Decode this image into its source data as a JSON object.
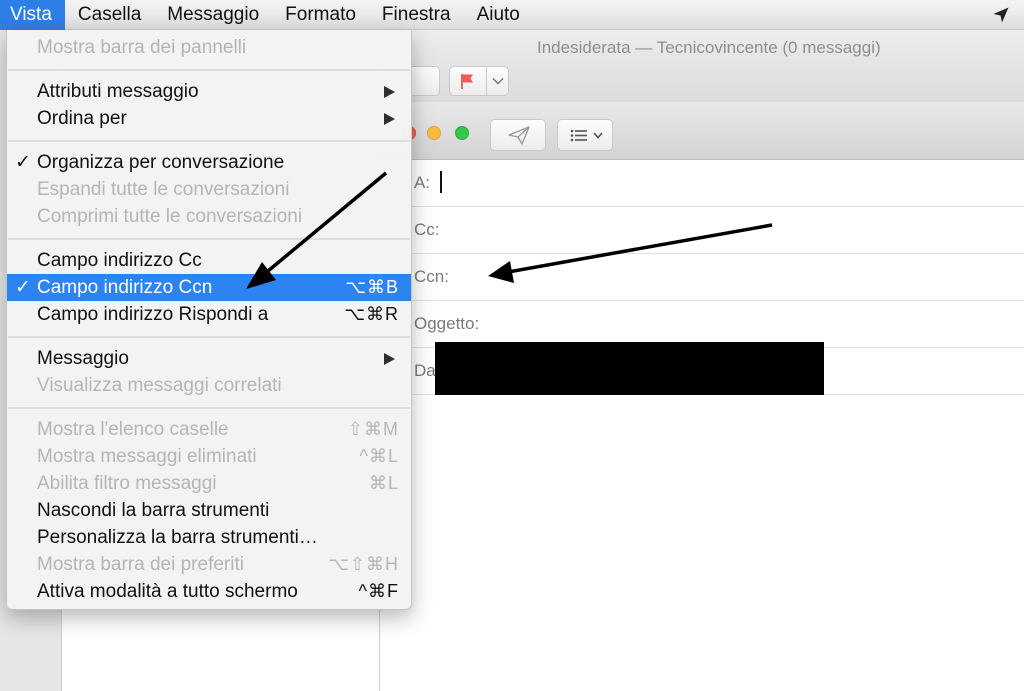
{
  "menubar": {
    "items": [
      "Vista",
      "Casella",
      "Messaggio",
      "Formato",
      "Finestra",
      "Aiuto"
    ],
    "active": "Vista",
    "right_icon": "location-arrow-icon"
  },
  "viewer": {
    "title": "Indesiderata — Tecnicovincente (0 messaggi)",
    "flag_color": "#f25a5a"
  },
  "compose": {
    "fields": {
      "to_label": "A:",
      "cc_label": "Cc:",
      "bcc_label": "Ccn:",
      "subject_label": "Oggetto:",
      "from_label": "Da"
    },
    "traffic_colors": {
      "close": "#fc605c",
      "minimize": "#fdbc40",
      "maximize": "#34c84a"
    }
  },
  "menu": {
    "items": [
      {
        "label": "Mostra barra dei pannelli",
        "disabled": true
      },
      {
        "label": "Attributi messaggio",
        "submenu": true
      },
      {
        "label": "Ordina per",
        "submenu": true
      },
      {
        "label": "Organizza per conversazione",
        "checked": true
      },
      {
        "label": "Espandi tutte le conversazioni",
        "disabled": true
      },
      {
        "label": "Comprimi tutte le conversazioni",
        "disabled": true
      },
      {
        "label": "Campo indirizzo Cc"
      },
      {
        "label": "Campo indirizzo Ccn",
        "checked": true,
        "selected": true,
        "shortcut": "⌥⌘B"
      },
      {
        "label": "Campo indirizzo Rispondi a",
        "shortcut": "⌥⌘R"
      },
      {
        "label": "Messaggio",
        "submenu": true
      },
      {
        "label": "Visualizza messaggi correlati",
        "disabled": true
      },
      {
        "label": "Mostra l'elenco caselle",
        "disabled": true,
        "shortcut": "⇧⌘M"
      },
      {
        "label": "Mostra messaggi eliminati",
        "disabled": true,
        "shortcut": "^⌘L"
      },
      {
        "label": "Abilita filtro messaggi",
        "disabled": true,
        "shortcut": "⌘L"
      },
      {
        "label": "Nascondi la barra strumenti"
      },
      {
        "label": "Personalizza la barra strumenti…"
      },
      {
        "label": "Mostra barra dei preferiti",
        "disabled": true,
        "shortcut": "⌥⇧⌘H"
      },
      {
        "label": "Attiva modalità a tutto schermo",
        "shortcut": "^⌘F"
      }
    ],
    "check_glyph": "✓",
    "selection_color": "#2d83f0"
  }
}
